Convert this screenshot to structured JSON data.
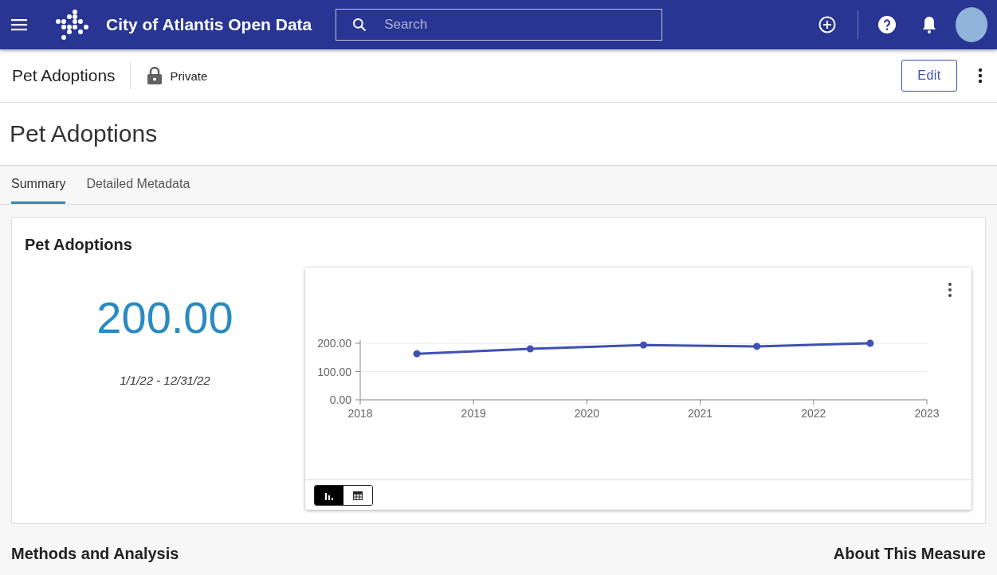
{
  "app_bar": {
    "title": "City of Atlantis Open Data",
    "search": {
      "placeholder": "Search"
    }
  },
  "item_header": {
    "title": "Pet Adoptions",
    "access": "Private",
    "edit_button": "Edit"
  },
  "page_title": "Pet Adoptions",
  "tabs": [
    {
      "label": "Summary",
      "selected": true
    },
    {
      "label": "Detailed Metadata",
      "selected": false
    }
  ],
  "measure_card": {
    "title": "Pet Adoptions",
    "value": "200.00",
    "date_range": "1/1/22 - 12/31/22",
    "view_toggle": [
      {
        "kind": "chart",
        "selected": true
      },
      {
        "kind": "table",
        "selected": false
      }
    ],
    "chart_data": {
      "type": "line",
      "x": [
        2018.5,
        2019.5,
        2020.5,
        2021.5,
        2022.5
      ],
      "series": [
        {
          "color": "#3f51b5",
          "marker": true,
          "values": [
            163,
            180,
            194,
            189,
            200
          ]
        }
      ],
      "xlim": [
        2018,
        2023
      ],
      "ylim": [
        0,
        200
      ],
      "xticks": [
        2018,
        2019,
        2020,
        2021,
        2022,
        2023
      ],
      "yticks": [
        {
          "value": 0,
          "label": "0.00"
        },
        {
          "value": 100,
          "label": "100.00"
        },
        {
          "value": 200,
          "label": "200.00"
        }
      ]
    }
  },
  "sections": [
    {
      "title": "Methods and Analysis"
    },
    {
      "title": "About This Measure"
    }
  ]
}
